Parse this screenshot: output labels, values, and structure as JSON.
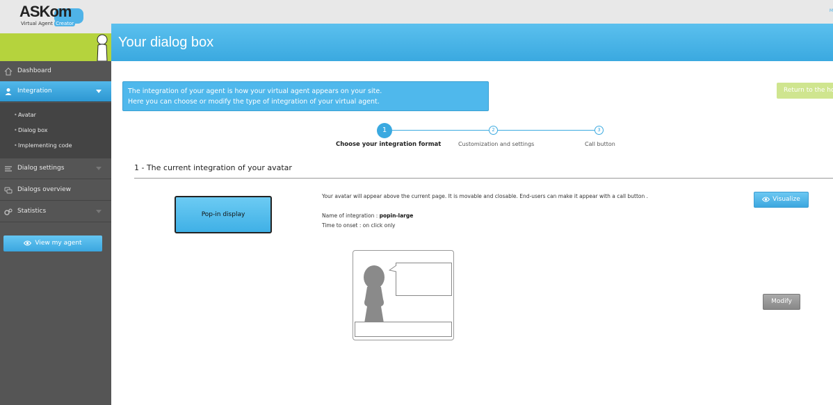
{
  "header": {
    "logo_text": "ASKom",
    "logo_sub": "Virtual Agent",
    "logo_badge": "Creator",
    "top_right": "M"
  },
  "page_title": "Your dialog box",
  "sidebar": {
    "items": [
      {
        "label": "Dashboard",
        "icon": "home-icon"
      },
      {
        "label": "Integration",
        "icon": "user-icon"
      },
      {
        "label": "Dialog settings",
        "icon": "list-icon"
      },
      {
        "label": "Dialogs overview",
        "icon": "chat-icon"
      },
      {
        "label": "Statistics",
        "icon": "gears-icon"
      }
    ],
    "submenu": [
      "Avatar",
      "Dialog box",
      "Implementing code"
    ],
    "view_agent": "View my agent"
  },
  "info": {
    "line1": "The integration of your agent is how your virtual agent appears on your site.",
    "line2": "Here you can choose or modify the type of integration of your virtual agent."
  },
  "return_btn": "Return to the home",
  "steps": [
    {
      "num": "1",
      "label": "Choose your integration format"
    },
    {
      "num": "2",
      "label": "Customization and settings"
    },
    {
      "num": "3",
      "label": "Call button"
    }
  ],
  "section_title": "1 - The current integration of your avatar",
  "integration": {
    "button": "Pop-in display",
    "description": "Your avatar will appear above the current page. It is movable and closable. End-users can make it appear with a call button .",
    "name_label": "Name of integration :",
    "name_value": "popin-large",
    "onset_label": "Time to onset :",
    "onset_value": "on click only"
  },
  "visualize_btn": "Visualize",
  "modify_btn": "Modify",
  "colors": {
    "accent_blue": "#3aa9e0",
    "green": "#b5d33d",
    "sidebar": "#555555"
  }
}
